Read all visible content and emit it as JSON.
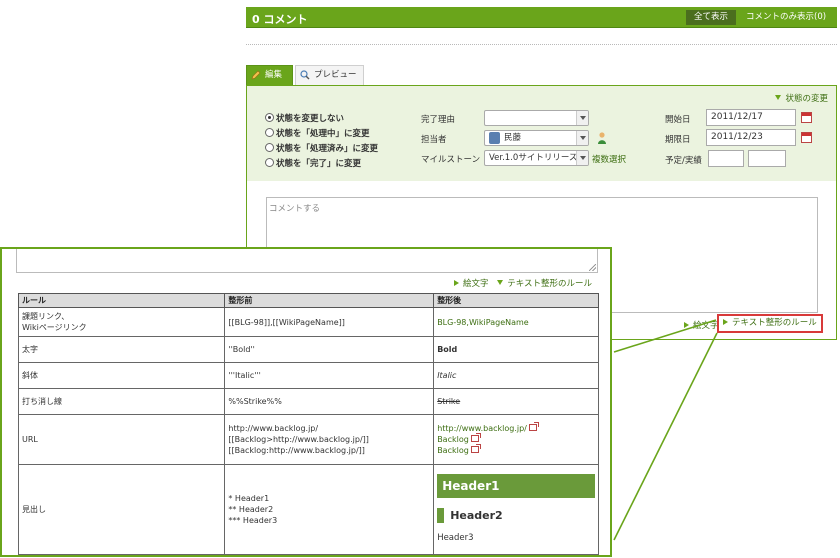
{
  "header": {
    "title": "0 コメント",
    "show_all": "全て表示",
    "show_comments": "コメントのみ表示(0)"
  },
  "tabs": [
    {
      "label": "編集",
      "icon": "pencil-icon"
    },
    {
      "label": "プレビュー",
      "icon": "magnifier-icon"
    }
  ],
  "status_toggle": "状態の変更",
  "status_options": [
    {
      "label": "状態を変更しない",
      "selected": true
    },
    {
      "label": "状態を「処理中」に変更",
      "selected": false
    },
    {
      "label": "状態を「処理済み」に変更",
      "selected": false
    },
    {
      "label": "状態を「完了」に変更",
      "selected": false
    }
  ],
  "fields": {
    "resolution_label": "完了理由",
    "resolution_value": "",
    "assignee_label": "担当者",
    "assignee_value": "民藤",
    "milestone_label": "マイルストーン",
    "milestone_value": "Ver.1.0サイトリリース",
    "multi_select": "複数選択",
    "start_label": "開始日",
    "start_value": "2011/12/17",
    "due_label": "期限日",
    "due_value": "2011/12/23",
    "estimate_label": "予定/実績"
  },
  "comment": {
    "placeholder": "コメントする"
  },
  "links": {
    "emoji": "絵文字",
    "text_rules": "テキスト整形のルール"
  },
  "rules_table": {
    "headers": [
      "ルール",
      "整形前",
      "整形後"
    ],
    "rows": [
      {
        "rule_lines": [
          "課題リンク、",
          "Wikiページリンク"
        ],
        "before": "[[BLG-98]],[[WikiPageName]]",
        "after": "BLG-98,WikiPageName"
      },
      {
        "rule": "太字",
        "before": "''Bold''",
        "after": "Bold"
      },
      {
        "rule": "斜体",
        "before": "'''Italic'''",
        "after": "Italic"
      },
      {
        "rule": "打ち消し線",
        "before": "%%Strike%%",
        "after": "Strike"
      },
      {
        "rule": "URL",
        "before_lines": [
          "http://www.backlog.jp/",
          "[[Backlog>http://www.backlog.jp/]]",
          "[[Backlog:http://www.backlog.jp/]]"
        ],
        "after_lines": [
          "http://www.backlog.jp/",
          "Backlog",
          "Backlog"
        ]
      },
      {
        "rule": "見出し",
        "before_lines": [
          "* Header1",
          "** Header2",
          "*** Header3"
        ],
        "after_lines": [
          "Header1",
          "Header2",
          "Header3"
        ]
      }
    ]
  },
  "colors": {
    "accent_green": "#6aa51b",
    "highlight_red": "#d83a3a"
  }
}
